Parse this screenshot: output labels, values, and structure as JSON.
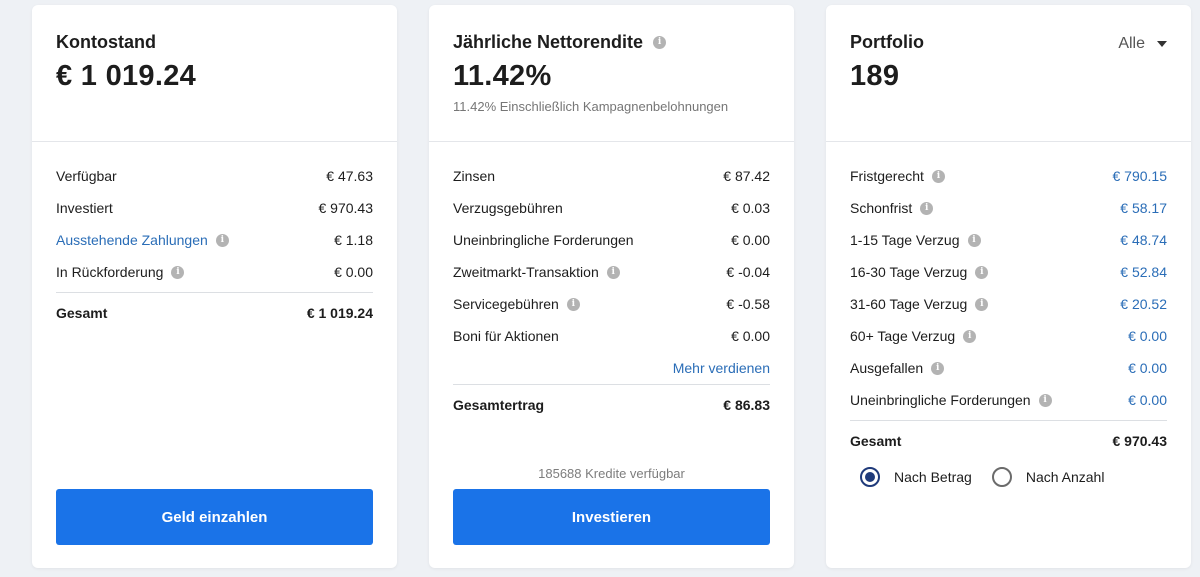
{
  "balance_card": {
    "title": "Kontostand",
    "amount": "€ 1 019.24",
    "rows": [
      {
        "label": "Verfügbar",
        "value": "€ 47.63"
      },
      {
        "label": "Investiert",
        "value": "€ 970.43"
      },
      {
        "label": "Ausstehende Zahlungen",
        "value": "€ 1.18"
      },
      {
        "label": "In Rückforderung",
        "value": "€ 0.00"
      }
    ],
    "total_label": "Gesamt",
    "total_value": "€ 1 019.24",
    "button_label": "Geld einzahlen"
  },
  "return_card": {
    "title": "Jährliche Nettorendite",
    "amount": "11.42%",
    "subtitle": "11.42% Einschließlich Kampagnenbelohnungen",
    "rows": [
      {
        "label": "Zinsen",
        "value": "€ 87.42"
      },
      {
        "label": "Verzugsgebühren",
        "value": "€ 0.03"
      },
      {
        "label": "Uneinbringliche Forderungen",
        "value": "€ 0.00"
      },
      {
        "label": "Zweitmarkt-Transaktion",
        "value": "€ -0.04"
      },
      {
        "label": "Servicegebühren",
        "value": "€ -0.58"
      },
      {
        "label": "Boni für Aktionen",
        "value": "€ 0.00"
      }
    ],
    "more_link": "Mehr verdienen",
    "total_label": "Gesamtertrag",
    "total_value": "€ 86.83",
    "credits_text": "185688 Kredite verfügbar",
    "button_label": "Investieren"
  },
  "portfolio_card": {
    "title": "Portfolio",
    "count": "189",
    "filter_selected": "Alle",
    "rows": [
      {
        "label": "Fristgerecht",
        "value": "€ 790.15"
      },
      {
        "label": "Schonfrist",
        "value": "€ 58.17"
      },
      {
        "label": "1-15 Tage Verzug",
        "value": "€ 48.74"
      },
      {
        "label": "16-30 Tage Verzug",
        "value": "€ 52.84"
      },
      {
        "label": "31-60 Tage Verzug",
        "value": "€ 20.52"
      },
      {
        "label": "60+ Tage Verzug",
        "value": "€ 0.00"
      },
      {
        "label": "Ausgefallen",
        "value": "€ 0.00"
      },
      {
        "label": "Uneinbringliche Forderungen",
        "value": "€ 0.00"
      }
    ],
    "total_label": "Gesamt",
    "total_value": "€ 970.43",
    "radio_by_amount": "Nach Betrag",
    "radio_by_count": "Nach Anzahl"
  },
  "colors": {
    "accent": "#1a73e8",
    "link": "#2a6db7",
    "background": "#eef1f5",
    "radio_checked": "#1f3a7a"
  }
}
